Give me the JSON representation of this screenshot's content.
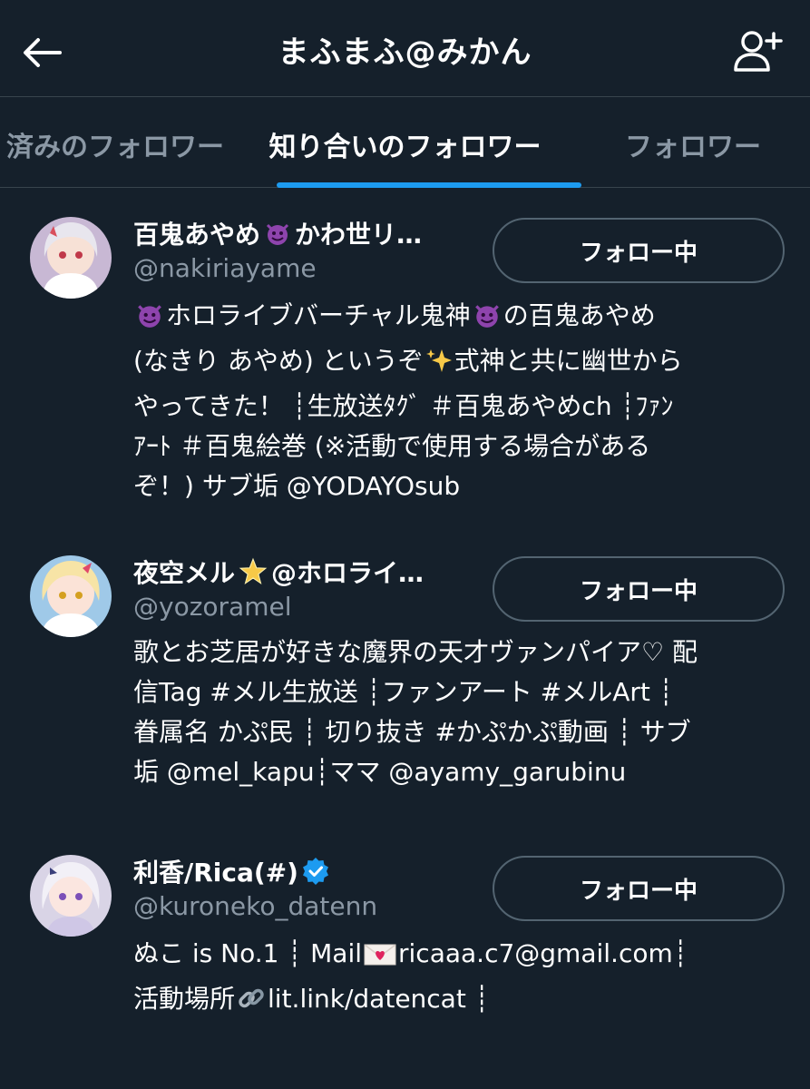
{
  "header": {
    "title": "まふまふ@みかん",
    "back_icon": "arrow-left-icon",
    "add_user_icon": "person-add-icon"
  },
  "tabs": [
    {
      "label": "済みのフォロワー",
      "active": false
    },
    {
      "label": "知り合いのフォロワー",
      "active": true
    },
    {
      "label": "フォロワー",
      "active": false
    }
  ],
  "colors": {
    "background": "#15202b",
    "accent": "#1d9bf0",
    "muted_text": "#8b98a5",
    "border": "#38444d"
  },
  "users": [
    {
      "name_before": "百鬼あやめ",
      "name_emoji": "smiling-imp-emoji",
      "name_after": "かわ世リ…",
      "handle": "@nakiriayame",
      "follow_label": "フォロー中",
      "bio_lines": [
        [
          "",
          "smiling-imp-emoji",
          "ホロライブバーチャル鬼神",
          "smiling-imp-emoji",
          "の百鬼あやめ"
        ],
        [
          "(なきり あやめ) というぞ",
          "sparkles-emoji",
          "式神と共に幽世から"
        ],
        [
          "やってきた！ ┊生放送ﾀｸﾞ ＃百鬼あやめch ┊ﾌｧﾝ"
        ],
        [
          "ｱｰﾄ ＃百鬼絵巻 (※活動で使用する場合がある"
        ],
        [
          "ぞ！) サブ垢 @YODAYOsub"
        ]
      ]
    },
    {
      "name_before": "夜空メル",
      "name_emoji": "glowing-star-emoji",
      "name_after": "@ホロライ…",
      "handle": "@yozoramel",
      "follow_label": "フォロー中",
      "bio_lines": [
        [
          "歌とお芝居が好きな魔界の天才ヴァンパイア♡ 配"
        ],
        [
          "信Tag #メル生放送 ┊ファンアート #メルArt ┊"
        ],
        [
          "眷属名 かぷ民 ┊ 切り抜き #かぷかぷ動画 ┊ サブ"
        ],
        [
          "垢 @mel_kapu┊ママ @ayamy_garubinu"
        ]
      ]
    },
    {
      "name_before": "利香/Rica(#)",
      "name_emoji": "verified-badge-icon",
      "name_after": "",
      "handle": "@kuroneko_datenn",
      "follow_label": "フォロー中",
      "bio_lines": [
        [
          "ぬこ is No.1 ┊ Mail",
          "love-letter-emoji",
          "ricaaa.c7@gmail.com┊"
        ],
        [
          "活動場所",
          "link-emoji",
          "lit.link/datencat ┊"
        ]
      ]
    }
  ]
}
